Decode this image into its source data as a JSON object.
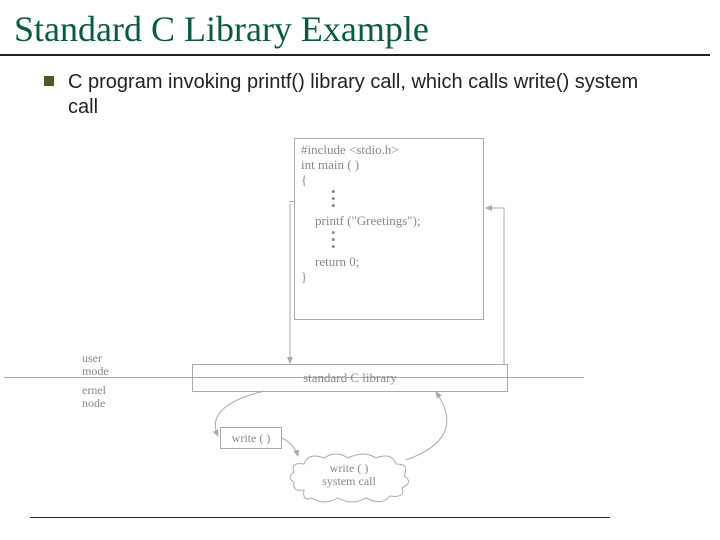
{
  "title": "Standard C Library Example",
  "bullet": "C program invoking printf() library call, which calls write() system call",
  "diagram": {
    "code": {
      "l1": "#include <stdio.h>",
      "l2": "int main ( )",
      "l3": "{",
      "printf": "printf (\"Greetings\");",
      "ret": "return 0;",
      "l_close": "}"
    },
    "lib_label": "standard C library",
    "user_mode": "user\nmode",
    "kernel_mode": "ernel\nnode",
    "write_label": "write ( )",
    "cloud_l1": "write ( )",
    "cloud_l2": "system call"
  }
}
